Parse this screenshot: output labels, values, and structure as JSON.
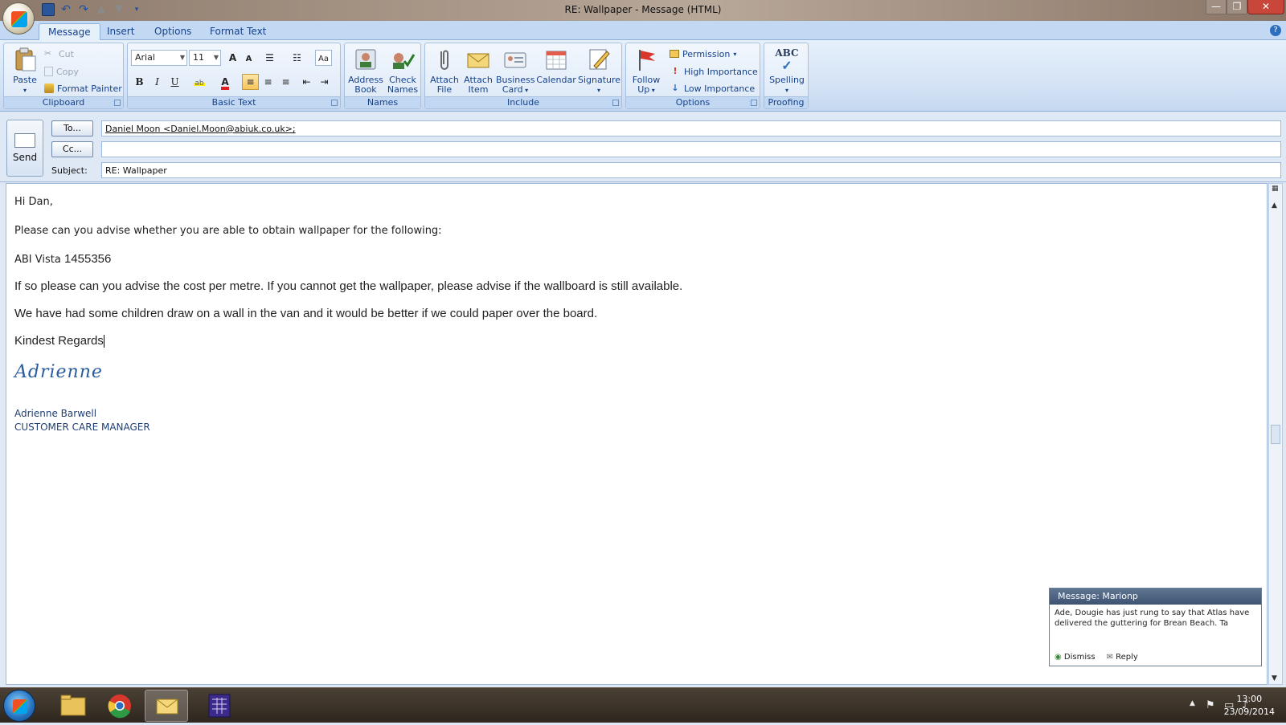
{
  "window": {
    "title": "RE: Wallpaper - Message (HTML)",
    "minimize": "—",
    "maximize": "❐",
    "close": "✕"
  },
  "tabs": [
    "Message",
    "Insert",
    "Options",
    "Format Text"
  ],
  "help_glyph": "?",
  "ribbon": {
    "clipboard": {
      "label": "Clipboard",
      "paste": "Paste",
      "cut": "Cut",
      "copy": "Copy",
      "format_painter": "Format Painter"
    },
    "basic_text": {
      "label": "Basic Text",
      "font": "Arial",
      "size": "11",
      "grow": "A",
      "shrink": "A",
      "bold": "B",
      "italic": "I",
      "underline": "U",
      "font_color": "A"
    },
    "names": {
      "label": "Names",
      "address_book": [
        "Address",
        "Book"
      ],
      "check_names": [
        "Check",
        "Names"
      ]
    },
    "include": {
      "label": "Include",
      "attach_file": [
        "Attach",
        "File"
      ],
      "attach_item": [
        "Attach",
        "Item"
      ],
      "business_card": [
        "Business",
        "Card"
      ],
      "calendar": "Calendar",
      "signature": "Signature"
    },
    "options": {
      "label": "Options",
      "follow_up": [
        "Follow",
        "Up"
      ],
      "permission": "Permission",
      "high_importance": "High Importance",
      "low_importance": "Low Importance"
    },
    "proofing": {
      "label": "Proofing",
      "spelling": "Spelling",
      "abc": "ABC"
    }
  },
  "header": {
    "send": "Send",
    "to_button": "To...",
    "cc_button": "Cc...",
    "subject_label": "Subject:",
    "to_value": "Daniel Moon <Daniel.Moon@abiuk.co.uk>;",
    "cc_value": "",
    "subject_value": "RE: Wallpaper"
  },
  "message": {
    "greeting": "Hi Dan,",
    "line1": "Please can you advise whether you are able to obtain wallpaper for the following:",
    "line2a": "ABI Vista ",
    "line2b": "1455356",
    "line3": "If so please can you advise the cost per metre.  If you cannot get the wallpaper, please advise if the wallboard is still available.",
    "line4": "We have had some children draw on a wall in the van and it would be better if we could paper over the board.",
    "closing": "Kindest Regards",
    "signature_script": "Adrienne",
    "sender_name": "Adrienne Barwell",
    "sender_title": "CUSTOMER CARE MANAGER"
  },
  "notification": {
    "header": "Message: Marionp",
    "body": "Ade, Dougie has just rung to say that Atlas have delivered the guttering for Brean Beach. Ta",
    "dismiss": "Dismiss",
    "reply": "Reply"
  },
  "taskbar": {
    "time": "13:00",
    "date": "23/09/2014"
  },
  "colors": {
    "accent": "#15428b",
    "ribbon_bg": "#dfe9f5",
    "signature": "#2a5d9e",
    "notification_header": "#4a6180"
  }
}
